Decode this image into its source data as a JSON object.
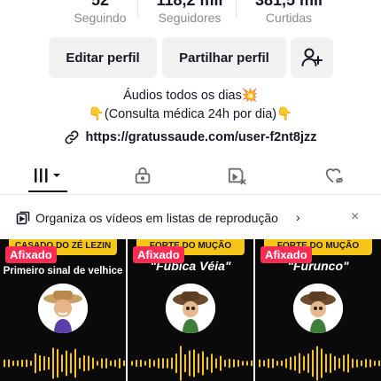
{
  "stats": [
    {
      "value": "52",
      "label": "Seguindo"
    },
    {
      "value": "118,2 mil",
      "label": "Seguidores"
    },
    {
      "value": "381,5 mil",
      "label": "Curtidas"
    }
  ],
  "buttons": {
    "edit_profile": "Editar perfil",
    "share_profile": "Partilhar perfil",
    "add_friend_icon": "person-add-icon"
  },
  "bio": {
    "line1": "Áudios todos os dias💥",
    "line2": "👇(Consulta médica 24h por dia)👇",
    "link": "https://gratussaude.com/user-f2nt8jzz"
  },
  "tabs": [
    {
      "icon": "videos-grid-icon",
      "active": true
    },
    {
      "icon": "lock-icon",
      "active": false
    },
    {
      "icon": "reposts-icon",
      "active": false
    },
    {
      "icon": "liked-hidden-icon",
      "active": false
    }
  ],
  "playlist_banner": {
    "text": "Organiza os vídeos em listas de reprodução",
    "chevron": "›",
    "close": "×"
  },
  "videos": [
    {
      "pinned": "Afixado",
      "banner": "CASADO DO ZÉ LEZIN",
      "subtitle": "Primeiro sinal de velhice",
      "accent": "#f5c518"
    },
    {
      "pinned": "Afixado",
      "banner": "FORTE DO MUÇÃO",
      "subtitle": "\"Fubica Véia\"",
      "accent": "#f5c518"
    },
    {
      "pinned": "Afixado",
      "banner": "FORTE DO MUÇÃO",
      "subtitle": "\"Furunco\"",
      "accent": "#f5c518"
    }
  ],
  "colors": {
    "pin_red": "#fe2c55",
    "text": "#161823",
    "muted": "#8a8b91",
    "button_bg": "#f1f1f2",
    "wave_yellow": "#f5c518"
  }
}
